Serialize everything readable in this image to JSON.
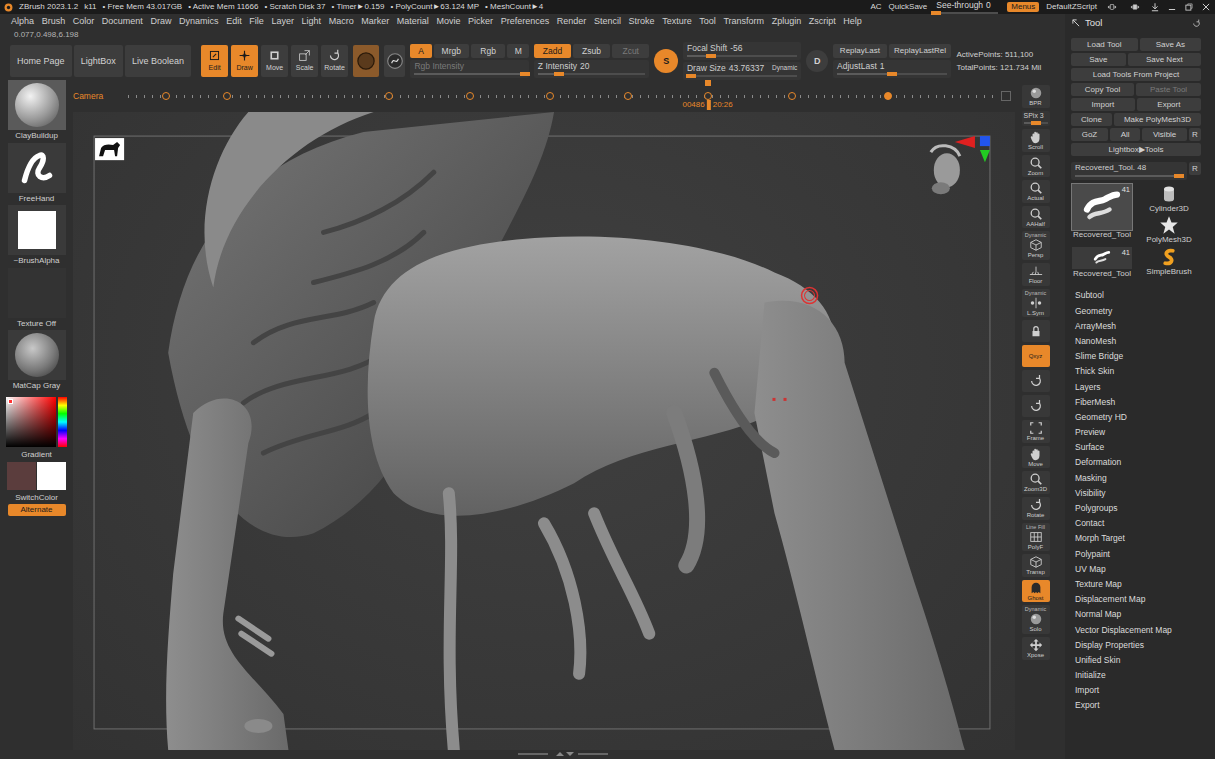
{
  "title_bar": {
    "app": "ZBrush 2023.1.2",
    "build": "k11",
    "stats": [
      "• Free Mem 43.017GB",
      "• Active Mem 11666",
      "• Scratch Disk 37",
      "• Timer►0.159",
      "• PolyCount►63.124 MP",
      "• MeshCount►4"
    ],
    "ac": "AC",
    "quicksave": "QuickSave",
    "see_through": {
      "label": "See-through",
      "value": "0",
      "level": 0.0
    },
    "menus": {
      "label": "Menus",
      "selected": true
    },
    "script": "DefaultZScript"
  },
  "menu_bar": [
    "Alpha",
    "Brush",
    "Color",
    "Document",
    "Draw",
    "Dynamics",
    "Edit",
    "File",
    "Layer",
    "Light",
    "Macro",
    "Marker",
    "Material",
    "Movie",
    "Picker",
    "Preferences",
    "Render",
    "Stencil",
    "Stroke",
    "Texture",
    "Tool",
    "Transform",
    "Zplugin",
    "Zscript",
    "Help"
  ],
  "coords": "0.077,0.498,6.198",
  "shelf": {
    "nav": [
      "Home Page",
      "LightBox",
      "Live Boolean"
    ],
    "modes": [
      {
        "label": "Edit",
        "selected": true
      },
      {
        "label": "Draw",
        "selected": true
      },
      {
        "label": "Move",
        "selected": false
      },
      {
        "label": "Scale",
        "selected": false
      },
      {
        "label": "Rotate",
        "selected": false
      }
    ],
    "color_modes": [
      {
        "label": "A",
        "selected": true
      },
      {
        "label": "Mrgb",
        "selected": false
      },
      {
        "label": "Rgb",
        "selected": false
      },
      {
        "label": "M",
        "selected": false
      }
    ],
    "rgb_intensity": {
      "label": "Rgb Intensity",
      "level": 1.0,
      "disabled": true
    },
    "z_modes": [
      {
        "label": "Zadd",
        "selected": true,
        "disabled": false
      },
      {
        "label": "Zsub",
        "selected": false,
        "disabled": false
      },
      {
        "label": "Zcut",
        "selected": false,
        "disabled": true
      }
    ],
    "z_intensity": {
      "label": "Z Intensity",
      "value": "20",
      "level": 0.2
    },
    "s_button": {
      "label": "S",
      "selected": true
    },
    "focal_shift": {
      "label": "Focal Shift",
      "value": "-56",
      "level": 0.22
    },
    "draw_size": {
      "label": "Draw Size",
      "value": "43.76337",
      "level": 0.04
    },
    "dynamic": "Dynamic",
    "d_button": {
      "label": "D",
      "selected": false
    },
    "replay_last": "ReplayLast",
    "replay_last_rel": "ReplayLastRel",
    "adjust_last": {
      "label": "AdjustLast",
      "value": "1",
      "level": 0.5
    },
    "active_points": "ActivePoints: 511,100",
    "total_points": "TotalPoints: 121.734 Mil"
  },
  "left_shelf": {
    "slots": [
      {
        "label": "ClayBuildup",
        "kind": "brush"
      },
      {
        "label": "FreeHand",
        "kind": "stroke"
      },
      {
        "label": "~BrushAlpha",
        "kind": "alpha"
      },
      {
        "label": "Texture Off",
        "kind": "texture"
      },
      {
        "label": "MatCap Gray",
        "kind": "material"
      }
    ],
    "gradient": "Gradient",
    "swatches": [
      {
        "color": "#5b3d3d"
      },
      {
        "color": "#ffffff"
      }
    ],
    "switch_color": "SwitchColor",
    "alternate": {
      "label": "Alternate",
      "selected": true
    }
  },
  "timeline": {
    "label": "Camera",
    "frame": "00486",
    "time": "20:26",
    "level": 0.667,
    "keys": [
      {
        "level": 0.044,
        "selected": false
      },
      {
        "level": 0.114,
        "selected": false
      },
      {
        "level": 0.3,
        "selected": false
      },
      {
        "level": 0.393,
        "selected": false
      },
      {
        "level": 0.486,
        "selected": false
      },
      {
        "level": 0.575,
        "selected": false
      },
      {
        "level": 0.667,
        "selected": false
      },
      {
        "level": 0.764,
        "selected": false
      },
      {
        "level": 0.875,
        "selected": true
      }
    ]
  },
  "right_shelf": [
    {
      "kind": "button",
      "label": "BPR",
      "selected": false
    },
    {
      "kind": "slider",
      "label": "SPix 3",
      "level": 0.5
    },
    {
      "kind": "button",
      "label": "Scroll",
      "selected": false
    },
    {
      "kind": "button",
      "label": "Zoom",
      "selected": false
    },
    {
      "kind": "button",
      "label": "Actual",
      "selected": false
    },
    {
      "kind": "button",
      "label": "AAHalf",
      "selected": false
    },
    {
      "kind": "button",
      "top": "Dynamic",
      "label": "Persp",
      "selected": false
    },
    {
      "kind": "button",
      "label": "Floor",
      "selected": false
    },
    {
      "kind": "button",
      "top": "Dynamic",
      "label": "L.Sym",
      "selected": false
    },
    {
      "kind": "icon",
      "selected": false
    },
    {
      "kind": "button",
      "label": "Qxyz",
      "selected": true
    },
    {
      "kind": "icon",
      "selected": false
    },
    {
      "kind": "icon",
      "selected": false
    },
    {
      "kind": "button",
      "label": "Frame",
      "selected": false
    },
    {
      "kind": "button",
      "label": "Move",
      "selected": false
    },
    {
      "kind": "button",
      "label": "Zoom3D",
      "selected": false
    },
    {
      "kind": "button",
      "label": "Rotate",
      "selected": false
    },
    {
      "kind": "button",
      "top": "Line Fill",
      "label": "PolyF",
      "selected": false
    },
    {
      "kind": "button",
      "label": "Transp",
      "selected": false
    },
    {
      "kind": "button",
      "label": "Ghost",
      "selected": true
    },
    {
      "kind": "button",
      "top": "Dynamic",
      "label": "Solo",
      "selected": false
    },
    {
      "kind": "button",
      "label": "Xpose",
      "selected": false
    }
  ],
  "tool_palette": {
    "title": "Tool",
    "rows": [
      [
        {
          "label": "Load Tool",
          "disabled": false
        },
        {
          "label": "Save As",
          "disabled": false
        }
      ],
      [
        {
          "label": "Save",
          "disabled": false
        },
        {
          "label": "Save Next",
          "disabled": false
        }
      ],
      [
        {
          "label": "Load Tools From Project",
          "disabled": false
        }
      ],
      [
        {
          "label": "Copy Tool",
          "disabled": false
        },
        {
          "label": "Paste Tool",
          "disabled": true
        }
      ],
      [
        {
          "label": "Import",
          "disabled": false
        },
        {
          "label": "Export",
          "disabled": false
        }
      ],
      [
        {
          "label": "Clone",
          "disabled": false
        },
        {
          "label": "Make PolyMesh3D",
          "disabled": false
        }
      ],
      [
        {
          "label": "GoZ",
          "disabled": false
        },
        {
          "label": "All",
          "disabled": false
        },
        {
          "label": "Visible",
          "disabled": false
        },
        {
          "label": "R",
          "disabled": false
        }
      ],
      [
        {
          "label": "Lightbox▶Tools",
          "disabled": false
        }
      ]
    ],
    "current": {
      "label": "Recovered_Tool. 48",
      "level": 0.96
    },
    "reset": "R",
    "thumbs": [
      {
        "label": "Recovered_Tool",
        "count": "41",
        "kind": "large",
        "selected": true
      },
      {
        "label": "Cylinder3D",
        "kind": "cylinder",
        "selected": false
      },
      {
        "label": "PolyMesh3D",
        "kind": "polymesh",
        "selected": false
      },
      {
        "label": "Recovered_Tool",
        "count": "41",
        "kind": "small",
        "selected": false
      },
      {
        "label": "SimpleBrush",
        "kind": "brush",
        "selected": false
      }
    ],
    "sections": [
      "Subtool",
      "Geometry",
      "ArrayMesh",
      "NanoMesh",
      "Slime Bridge",
      "Thick Skin",
      "Layers",
      "FiberMesh",
      "Geometry HD",
      "Preview",
      "Surface",
      "Deformation",
      "Masking",
      "Visibility",
      "Polygroups",
      "Contact",
      "Morph Target",
      "Polypaint",
      "UV Map",
      "Texture Map",
      "Displacement Map",
      "Normal Map",
      "Vector Displacement Map",
      "Display Properties",
      "Unified Skin",
      "Initialize",
      "Import",
      "Export"
    ]
  }
}
